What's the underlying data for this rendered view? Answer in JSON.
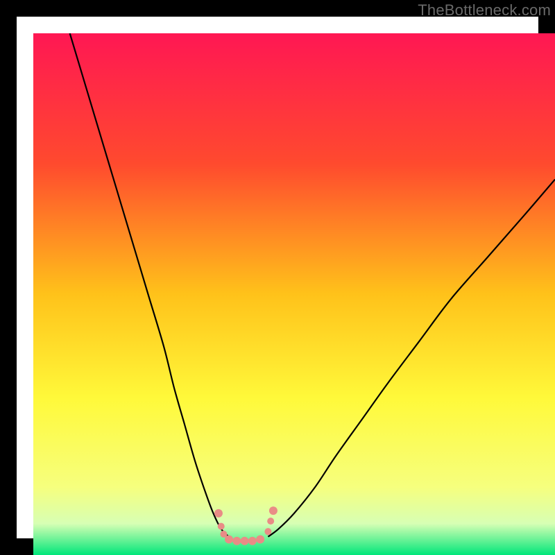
{
  "watermark": "TheBottleneck.com",
  "chart_data": {
    "type": "line",
    "title": "",
    "xlabel": "",
    "ylabel": "",
    "xlim": [
      0,
      100
    ],
    "ylim": [
      0,
      100
    ],
    "grid": false,
    "legend": false,
    "gradient_stops": [
      {
        "pct": 0,
        "color": "#ff1753"
      },
      {
        "pct": 25,
        "color": "#ff4a2e"
      },
      {
        "pct": 50,
        "color": "#ffc21a"
      },
      {
        "pct": 70,
        "color": "#fff93a"
      },
      {
        "pct": 87,
        "color": "#f6ff7e"
      },
      {
        "pct": 94,
        "color": "#d7ffb4"
      },
      {
        "pct": 100,
        "color": "#00e67a"
      }
    ],
    "curve_left": {
      "x": [
        7,
        10,
        13,
        16,
        19,
        22,
        25,
        27,
        29,
        31,
        33,
        34.5,
        36,
        37.5
      ],
      "y": [
        100,
        90,
        80,
        70,
        60,
        50,
        40,
        32,
        25,
        18,
        12,
        8,
        5,
        3.5
      ]
    },
    "curve_right": {
      "x": [
        45,
        47,
        50,
        54,
        58,
        63,
        68,
        74,
        80,
        87,
        94,
        100
      ],
      "y": [
        3.5,
        5,
        8,
        13,
        19,
        26,
        33,
        41,
        49,
        57,
        65,
        72
      ]
    },
    "valley_markers": {
      "color": "#e98c86",
      "points": [
        {
          "x": 35.5,
          "y": 8,
          "r": 6
        },
        {
          "x": 36,
          "y": 5.5,
          "r": 5
        },
        {
          "x": 36.5,
          "y": 4,
          "r": 5
        },
        {
          "x": 37.5,
          "y": 3,
          "r": 6
        },
        {
          "x": 39,
          "y": 2.7,
          "r": 6
        },
        {
          "x": 40.5,
          "y": 2.7,
          "r": 6
        },
        {
          "x": 42,
          "y": 2.7,
          "r": 6
        },
        {
          "x": 43.5,
          "y": 3,
          "r": 6
        },
        {
          "x": 45,
          "y": 4.5,
          "r": 5
        },
        {
          "x": 45.5,
          "y": 6.5,
          "r": 5
        },
        {
          "x": 46,
          "y": 8.5,
          "r": 6
        }
      ]
    }
  }
}
